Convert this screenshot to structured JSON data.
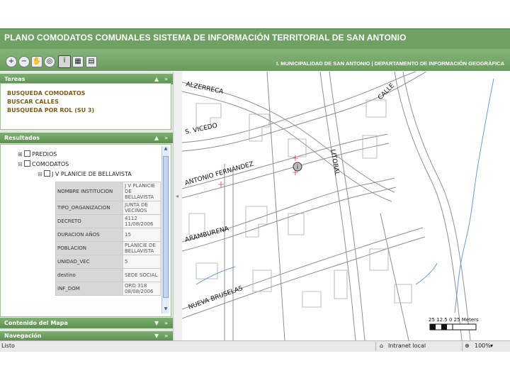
{
  "header": {
    "title": "PLANO COMODATOS COMUNALES   SISTEMA DE INFORMACIÓN TERRITORIAL DE SAN ANTONIO",
    "subtitle": "I. MUNICIPALIDAD DE SAN ANTONIO | DEPARTAMENTO DE INFORMACIÓN GEOGRÁFICA",
    "accent_color": "#6fa064"
  },
  "toolbar": {
    "tools": [
      "zoom-in-icon",
      "zoom-out-icon",
      "pan-hand-icon",
      "full-extent-icon",
      "identify-info-icon",
      "measure-icon",
      "print-icon"
    ]
  },
  "tareas": {
    "title": "Tareas",
    "items": [
      "BUSQUEDA COMODATOS",
      "BUSCAR CALLES",
      "BUSQUEDA POR ROL (SU 3)"
    ]
  },
  "resultados": {
    "title": "Resultados",
    "tree": {
      "predios": "PREDIOS",
      "comodatos": "COMODATOS",
      "feature": "J V PLANICIE DE BELLAVISTA"
    },
    "attributes": [
      {
        "key": "NOMBRE INSTITUCION",
        "value": "J V PLANICIE DE BELLAVISTA"
      },
      {
        "key": "TIPO_ORGANIZACION",
        "value": "JUNTA DE VECINOS"
      },
      {
        "key": "DECRETO",
        "value": "4112 11/08/2006"
      },
      {
        "key": "DURACION AÑOS",
        "value": "15"
      },
      {
        "key": "POBLACION",
        "value": "PLANICIE DE BELLAVISTA"
      },
      {
        "key": "UNIDAD_VEC",
        "value": "5"
      },
      {
        "key": "destino",
        "value": "SEDE SOCIAL"
      },
      {
        "key": "INF_DOM",
        "value": "ORD 318 08/08/2006"
      }
    ]
  },
  "panels": {
    "contenido": "Contenido del Mapa",
    "navegacion": "Navegación"
  },
  "map": {
    "streets": [
      "ALZERRECA",
      "CALLE",
      "S. VICEDO",
      "LITORAL",
      "ANTONIO FERNANDEZ",
      "ARAMBURENA",
      "NUEVA BRUSELAS"
    ],
    "scalebar": "25  12.5  0        25 Meters"
  },
  "status": {
    "left": "Listo",
    "zone": "Intranet local",
    "zoom": "100%"
  }
}
